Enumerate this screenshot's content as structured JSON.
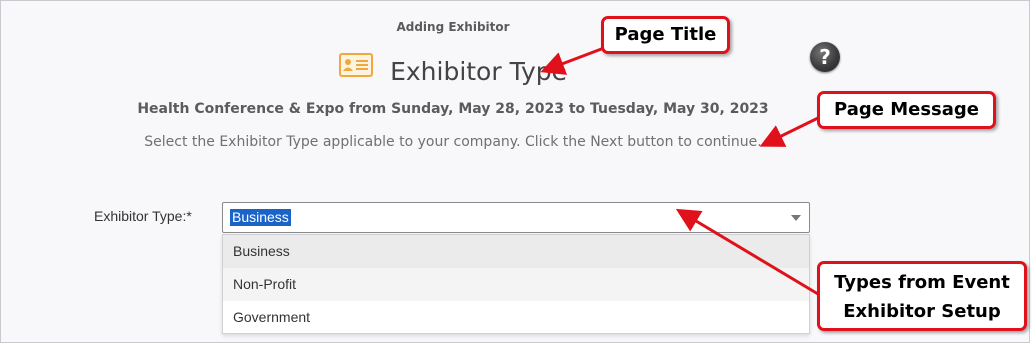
{
  "header": {
    "subheading": "Adding Exhibitor",
    "title": "Exhibitor Type",
    "title_icon": "id-card-icon",
    "help_label": "?"
  },
  "event": {
    "description": "Health Conference & Expo from Sunday, May 28, 2023 to Tuesday, May 30, 2023"
  },
  "message": "Select the Exhibitor Type applicable to your company. Click the Next button to continue.",
  "form": {
    "label": "Exhibitor Type:*",
    "selected": "Business",
    "options": [
      "Business",
      "Non-Profit",
      "Government"
    ]
  },
  "callouts": {
    "page_title": "Page Title",
    "page_message": "Page Message",
    "types_line1": "Types from Event",
    "types_line2": "Exhibitor Setup"
  },
  "colors": {
    "callout_border": "#e0111a",
    "selection": "#1a64c8",
    "icon": "#f0a83a"
  }
}
